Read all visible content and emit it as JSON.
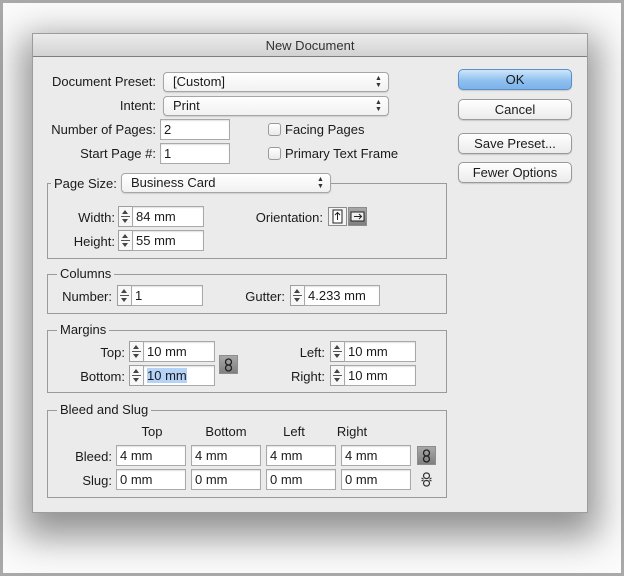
{
  "window": {
    "title": "New Document"
  },
  "top": {
    "document_preset": {
      "label": "Document Preset:",
      "value": "[Custom]"
    },
    "intent": {
      "label": "Intent:",
      "value": "Print"
    },
    "number_of_pages": {
      "label": "Number of Pages:",
      "value": "2"
    },
    "start_page": {
      "label": "Start Page #:",
      "value": "1"
    },
    "facing_pages": {
      "label": "Facing Pages",
      "checked": false
    },
    "primary_text_frame": {
      "label": "Primary Text Frame",
      "checked": false
    }
  },
  "buttons": {
    "ok": "OK",
    "cancel": "Cancel",
    "save_preset": "Save Preset...",
    "fewer_options": "Fewer Options"
  },
  "page_size": {
    "label": "Page Size:",
    "value": "Business Card",
    "width": {
      "label": "Width:",
      "value": "84 mm"
    },
    "height": {
      "label": "Height:",
      "value": "55 mm"
    },
    "orientation": {
      "label": "Orientation:",
      "selected": "landscape"
    }
  },
  "columns": {
    "title": "Columns",
    "number": {
      "label": "Number:",
      "value": "1"
    },
    "gutter": {
      "label": "Gutter:",
      "value": "4.233 mm"
    }
  },
  "margins": {
    "title": "Margins",
    "top": {
      "label": "Top:",
      "value": "10 mm"
    },
    "bottom": {
      "label": "Bottom:",
      "value": "10 mm"
    },
    "left": {
      "label": "Left:",
      "value": "10 mm"
    },
    "right": {
      "label": "Right:",
      "value": "10 mm"
    },
    "linked": true
  },
  "bleed_slug": {
    "title": "Bleed and Slug",
    "columns": [
      "Top",
      "Bottom",
      "Left",
      "Right"
    ],
    "bleed": {
      "label": "Bleed:",
      "values": [
        "4 mm",
        "4 mm",
        "4 mm",
        "4 mm"
      ],
      "linked": true
    },
    "slug": {
      "label": "Slug:",
      "values": [
        "0 mm",
        "0 mm",
        "0 mm",
        "0 mm"
      ],
      "linked": false
    }
  },
  "colors": {
    "ok_button": "#8fc0ef",
    "selection": "#b5d3f7",
    "dialog_bg": "#ebebeb"
  }
}
